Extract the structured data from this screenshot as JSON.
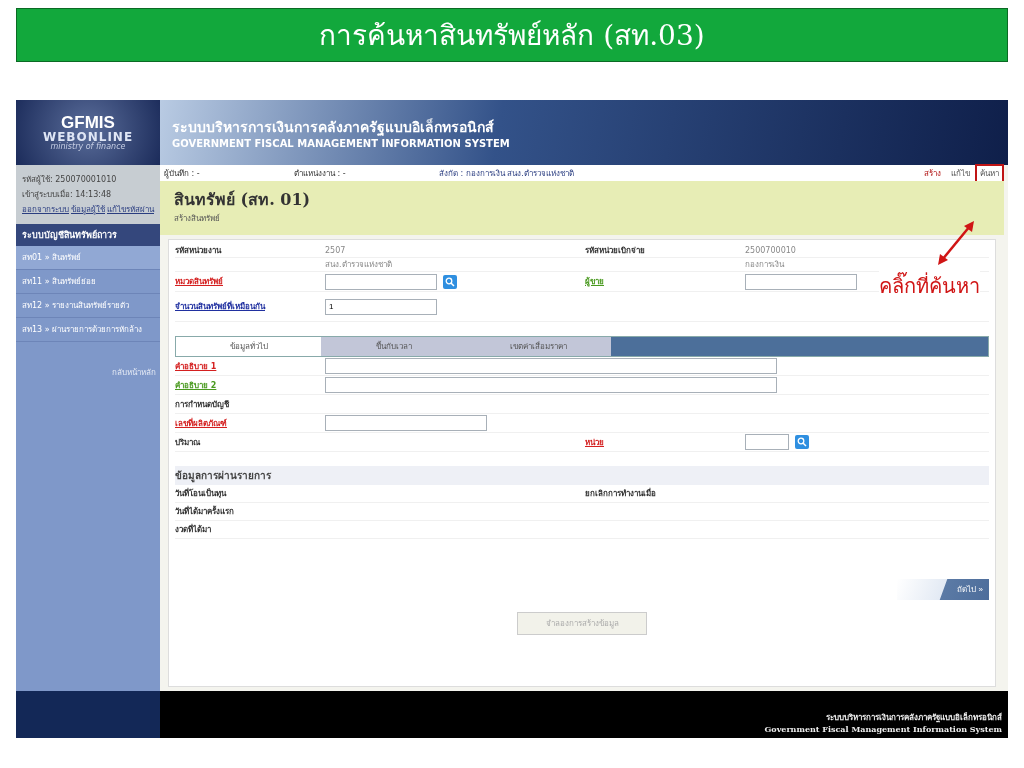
{
  "slide_title": "การค้นหาสินทรัพย์หลัก (สท.03)",
  "logo": {
    "line_1": "GFMIS",
    "line_2": "WEBONLINE",
    "line_3": "ministry of finance"
  },
  "header": {
    "title_th": "ระบบบริหารการเงินการคลังภาครัฐแบบอิเล็กทรอนิกส์",
    "title_en": "GOVERNMENT FISCAL MANAGEMENT INFORMATION SYSTEM"
  },
  "sidebar": {
    "user": "รหัสผู้ใช้: 250070001010",
    "login_time": "เข้าสู่ระบบเมื่อ: 14:13:48",
    "links": [
      "ออกจากระบบ",
      "ข้อมูลผู้ใช้",
      "แก้ไขรหัสผ่าน"
    ],
    "menu_title": "ระบบบัญชีสินทรัพย์ถาวร",
    "items": [
      {
        "label": "สท01 » สินทรัพย์",
        "selected": true
      },
      {
        "label": "สท11 » สินทรัพย์ย่อย",
        "selected": false
      },
      {
        "label": "สท12 » รายงานสินทรัพย์รายตัว",
        "selected": false
      },
      {
        "label": "สท13 » ผ่านรายการด้วยการหักล้าง",
        "selected": false
      }
    ],
    "back": "กลับหน้าหลัก"
  },
  "info_bar": {
    "recorder": "ผู้บันทึก : -",
    "position": "ตำแหน่งงาน : -",
    "affiliation_label": "สังกัด :",
    "affiliation": "กองการเงิน สนง.ตำรวจแห่งชาติ",
    "actions": [
      {
        "label": "สร้าง",
        "selected": true
      },
      {
        "label": "แก้ไข",
        "selected": false
      },
      {
        "label": "ค้นหา",
        "selected": false,
        "highlighted": true
      }
    ]
  },
  "page": {
    "title": "สินทรัพย์ (สท. 01)",
    "subtitle": "สร้างสินทรัพย์"
  },
  "header_fields": {
    "agency_label": "รหัสหน่วยงาน",
    "agency_code": "2507",
    "agency_name": "สนง.ตำรวจแห่งชาติ",
    "disbursing_label": "รหัสหน่วยเบิกจ่าย",
    "disbursing_code": "2500700010",
    "disbursing_name": "กองการเงิน",
    "links": [
      {
        "label": "หมวดสินทรัพย์",
        "color": "#d42020"
      },
      {
        "label": "ผู้ขาย",
        "color": "#4a9a20"
      },
      {
        "label": "จำนวนสินทรัพย์ที่เหมือนกัน",
        "color": "#2030a0"
      }
    ],
    "quantity_value": "1"
  },
  "tabs": [
    {
      "label": "ข้อมูลทั่วไป",
      "selected": true
    },
    {
      "label": "ขึ้นกับเวลา",
      "selected": false
    },
    {
      "label": "เขตค่าเสื่อมราคา",
      "selected": false
    }
  ],
  "general_fields": [
    {
      "label": "คำอธิบาย 1",
      "kind": "wide",
      "color": "#d42020"
    },
    {
      "label": "คำอธิบาย 2",
      "kind": "wide",
      "color": "#4a9a20"
    },
    {
      "label": "การกำหนดบัญชี",
      "kind": "plain"
    },
    {
      "label": "เลขที่ผลิตภัณฑ์",
      "kind": "medium",
      "color": "#d42020"
    },
    {
      "label": "ปริมาณ",
      "kind": "unit",
      "unit": {
        "label": "หน่วย",
        "color": "#d42020"
      }
    }
  ],
  "posting": {
    "title": "ข้อมูลการผ่านรายการ",
    "rows": [
      [
        "วันที่โอนเป็นทุน",
        "ยกเลิกการทำงานเมื่อ"
      ],
      [
        "วันที่ได้มาครั้งแรก"
      ],
      [
        "งวดที่ได้มา"
      ]
    ]
  },
  "next_button": "ถัดไป »",
  "simulate_button": {
    "label": "จำลองการสร้างข้อมูล",
    "disabled": true
  },
  "footer": {
    "line_th": "ระบบบริหารการเงินการคลังภาครัฐแบบอิเล็กทรอนิกส์",
    "line_en": "Government Fiscal Management Information System"
  },
  "annotation": "คลิ๊กที่ค้นหา"
}
